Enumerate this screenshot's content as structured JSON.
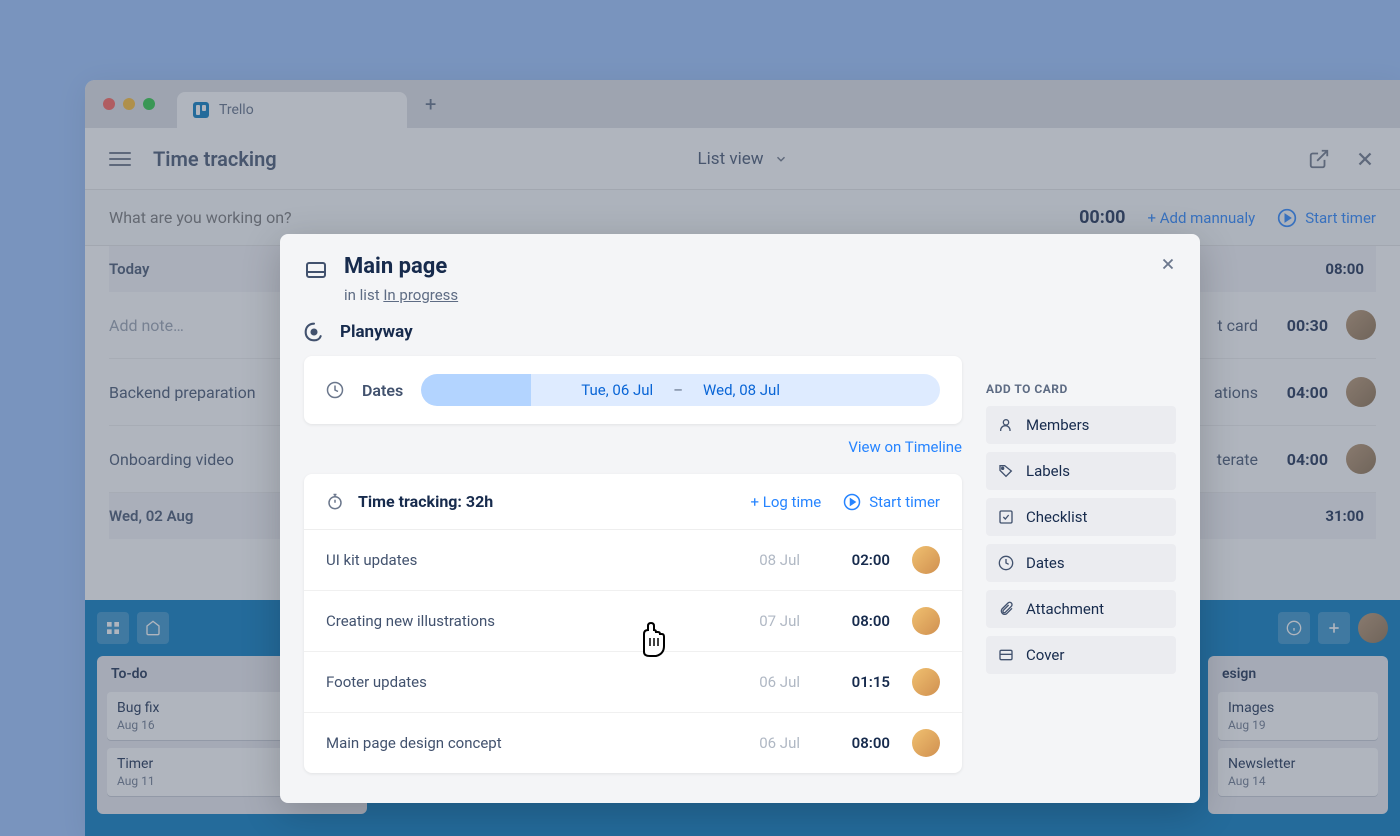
{
  "browser": {
    "tab_title": "Trello"
  },
  "header": {
    "page_title": "Time tracking",
    "view_selector": "List view"
  },
  "tracking_bar": {
    "placeholder": "What are you working on?",
    "timer": "00:00",
    "add_manual": "+ Add mannualy",
    "start_timer": "Start timer"
  },
  "entries": {
    "day1_label": "Today",
    "day1_total": "08:00",
    "add_note_placeholder": "Add note…",
    "row1_task": "Backend preparation",
    "row2_task": "Onboarding video",
    "row3_task_suffix": "t card",
    "row3_dur": "00:30",
    "row4_task_suffix": "ations",
    "row4_dur": "04:00",
    "row5_task_suffix": "terate",
    "row5_dur": "04:00",
    "day2_label": "Wed, 02 Aug",
    "day2_total": "31:00"
  },
  "board": {
    "list1_title": "To-do",
    "list1_card1_title": "Bug fix",
    "list1_card1_date": "Aug 16",
    "list1_card2_title": "Timer",
    "list1_card2_date": "Aug 11",
    "list2_title_partial": "esign",
    "list2_card1_title": "Images",
    "list2_card1_date": "Aug 19",
    "list2_card2_title": "Newsletter",
    "list2_card2_date": "Aug 14"
  },
  "modal": {
    "title": "Main page",
    "subtitle_prefix": "in list ",
    "subtitle_list": "In progress",
    "planyway_label": "Planyway",
    "dates_label": "Dates",
    "date_start": "Tue, 06 Jul",
    "date_sep": "–",
    "date_end": "Wed, 08 Jul",
    "timeline_link": "View on Timeline",
    "tt_label": "Time tracking: 32h",
    "tt_log": "+ Log time",
    "tt_start": "Start timer",
    "tt_rows": {
      "r1_name": "UI kit updates",
      "r1_date": "08 Jul",
      "r1_dur": "02:00",
      "r2_name": "Creating new illustrations",
      "r2_date": "07 Jul",
      "r2_dur": "08:00",
      "r3_name": "Footer updates",
      "r3_date": "06 Jul",
      "r3_dur": "01:15",
      "r4_name": "Main page design concept",
      "r4_date": "06 Jul",
      "r4_dur": "08:00"
    },
    "side": {
      "title": "ADD TO CARD",
      "members": "Members",
      "labels": "Labels",
      "checklist": "Checklist",
      "dates": "Dates",
      "attachment": "Attachment",
      "cover": "Cover"
    }
  }
}
